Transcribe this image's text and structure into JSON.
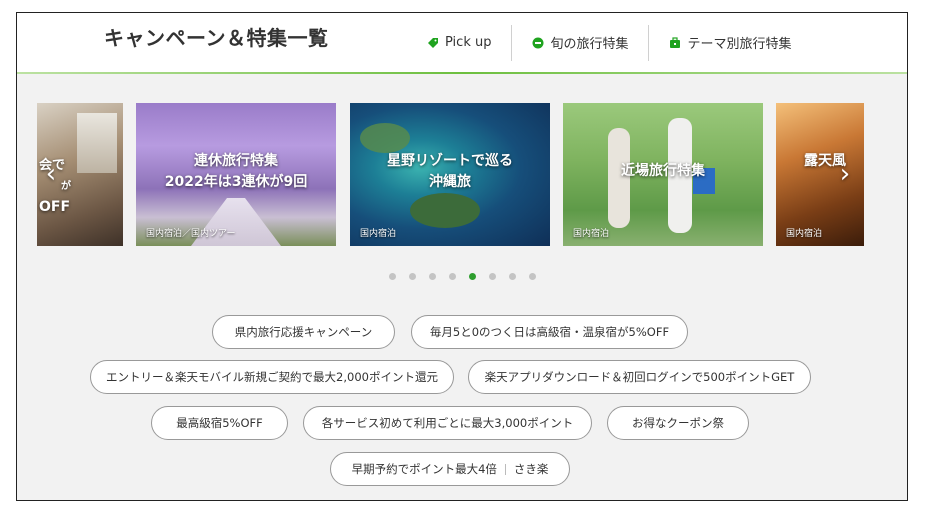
{
  "header": {
    "title": "キャンペーン＆特集一覧",
    "nav": [
      {
        "label": "Pick up",
        "icon": "tag-icon"
      },
      {
        "label": "旬の旅行特集",
        "icon": "new-badge-icon"
      },
      {
        "label": "テーマ別旅行特集",
        "icon": "suitcase-icon"
      }
    ]
  },
  "colors": {
    "accent": "#2e9e2e",
    "icon_green": "#1fa31f"
  },
  "carousel": {
    "prev_arrow": "‹",
    "next_arrow": "›",
    "slides": [
      {
        "title_lines": [
          "会で",
          "が",
          "OFF"
        ],
        "tag": ""
      },
      {
        "title_lines": [
          "連休旅行特集",
          "2022年は3連休が9回"
        ],
        "tag": "国内宿泊／国内ツアー"
      },
      {
        "title_lines": [
          "星野リゾートで巡る",
          "沖縄旅"
        ],
        "tag": "国内宿泊"
      },
      {
        "title_lines": [
          "近場旅行特集"
        ],
        "tag": "国内宿泊"
      },
      {
        "title_lines": [
          "露天風"
        ],
        "tag": "国内宿泊"
      }
    ],
    "dot_count": 8,
    "active_dot": 4
  },
  "campaigns": [
    {
      "label": "県内旅行応援キャンペーン"
    },
    {
      "label": "毎月5と0のつく日は高級宿・温泉宿が5%OFF"
    },
    {
      "label": "エントリー＆楽天モバイル新規ご契約で最大2,000ポイント還元"
    },
    {
      "label": "楽天アプリダウンロード＆初回ログインで500ポイントGET"
    },
    {
      "label": "最高級宿5%OFF"
    },
    {
      "label": "各サービス初めて利用ごとに最大3,000ポイント"
    },
    {
      "label": "お得なクーポン祭"
    },
    {
      "label": "早期予約でポイント最大4倍",
      "sub": "さき楽"
    }
  ]
}
